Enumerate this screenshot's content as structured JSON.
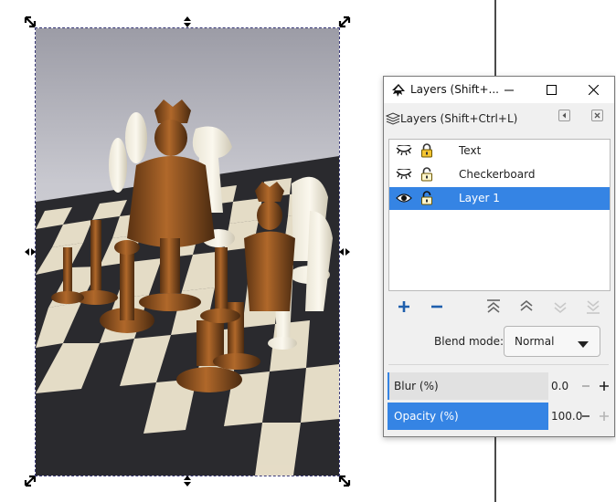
{
  "dialog": {
    "window_title": "Layers (Shift+...",
    "tab_label": "Layers (Shift+Ctrl+L)",
    "layers": [
      {
        "name": "Text",
        "visible": false,
        "locked": true,
        "selected": false
      },
      {
        "name": "Checkerboard",
        "visible": false,
        "locked": false,
        "selected": false
      },
      {
        "name": "Layer 1",
        "visible": true,
        "locked": false,
        "selected": true
      }
    ],
    "blend_mode_label": "Blend mode:",
    "blend_mode_value": "Normal",
    "blur": {
      "label": "Blur (%)",
      "value": "0.0",
      "fraction": 0.0
    },
    "opacity": {
      "label": "Opacity (%)",
      "value": "100.0",
      "fraction": 1.0
    }
  },
  "colors": {
    "selection": "#3584e4",
    "action_blue": "#1f5fad",
    "lock_yellow": "#f4c430"
  }
}
